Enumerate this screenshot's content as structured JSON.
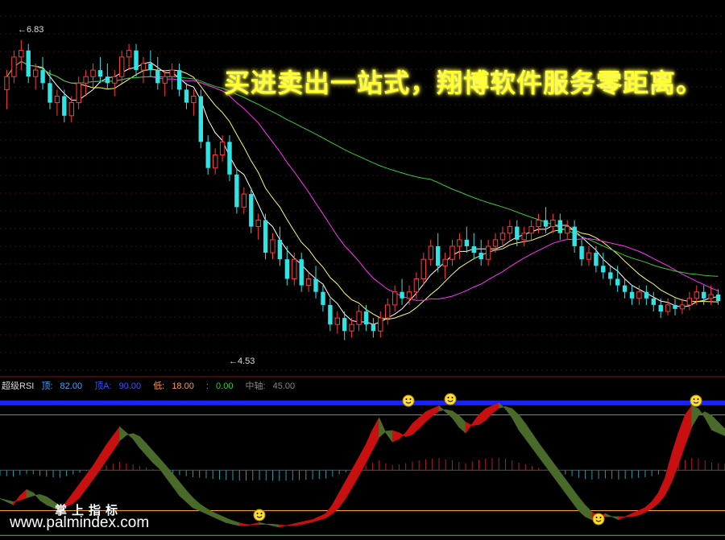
{
  "banner": "买进卖出一站式，翔博软件服务零距离。",
  "price_high_label": "6.83",
  "price_low_label": "4.53",
  "indicator": {
    "name": "超级RSI",
    "top_label": "顶:",
    "top_value": "82.00",
    "topA_label": "顶A:",
    "topA_value": "90.00",
    "low_label": "低:",
    "low_value": "18.00",
    "zero_label": ":",
    "zero_value": "0.00",
    "mid_label": "中轴:",
    "mid_value": "45.00",
    "colors": {
      "name": "#dddddd",
      "top": "#4aa3ff",
      "topA": "#3a55ff",
      "low": "#ff9a40",
      "zero": "#33cc33",
      "mid": "#888888"
    }
  },
  "watermark_cn": "掌上指标",
  "watermark_url": "www.palmindex.com",
  "colors": {
    "up": "#ff3b3b",
    "down": "#2ee5e5",
    "ma5": "#ffffff",
    "ma10": "#ffff66",
    "ma20": "#ff33ff",
    "ma60": "#33cc33",
    "rsi_up": "#c81010",
    "rsi_down": "#4a6a2a"
  },
  "chart_data": [
    {
      "type": "candlestick",
      "title": "",
      "series_names": [
        "MA5",
        "MA10",
        "MA20",
        "MA60"
      ],
      "ylim": [
        4.3,
        7.1
      ],
      "annotations": [
        {
          "text": "6.83",
          "x": 4
        },
        {
          "text": "4.53",
          "x": 47
        }
      ],
      "candles": [
        [
          6.45,
          6.6,
          6.3,
          6.55
        ],
        [
          6.55,
          6.75,
          6.5,
          6.7
        ],
        [
          6.7,
          6.83,
          6.6,
          6.75
        ],
        [
          6.75,
          6.8,
          6.5,
          6.55
        ],
        [
          6.55,
          6.65,
          6.45,
          6.6
        ],
        [
          6.6,
          6.7,
          6.45,
          6.5
        ],
        [
          6.5,
          6.6,
          6.3,
          6.35
        ],
        [
          6.35,
          6.45,
          6.25,
          6.4
        ],
        [
          6.4,
          6.45,
          6.2,
          6.25
        ],
        [
          6.25,
          6.4,
          6.2,
          6.35
        ],
        [
          6.35,
          6.55,
          6.3,
          6.5
        ],
        [
          6.5,
          6.6,
          6.4,
          6.55
        ],
        [
          6.55,
          6.65,
          6.45,
          6.6
        ],
        [
          6.6,
          6.7,
          6.5,
          6.55
        ],
        [
          6.55,
          6.65,
          6.45,
          6.5
        ],
        [
          6.5,
          6.6,
          6.4,
          6.55
        ],
        [
          6.55,
          6.75,
          6.5,
          6.7
        ],
        [
          6.7,
          6.8,
          6.6,
          6.75
        ],
        [
          6.75,
          6.8,
          6.55,
          6.6
        ],
        [
          6.6,
          6.7,
          6.5,
          6.65
        ],
        [
          6.65,
          6.75,
          6.55,
          6.6
        ],
        [
          6.6,
          6.7,
          6.45,
          6.5
        ],
        [
          6.5,
          6.6,
          6.4,
          6.55
        ],
        [
          6.55,
          6.65,
          6.45,
          6.6
        ],
        [
          6.6,
          6.65,
          6.4,
          6.45
        ],
        [
          6.45,
          6.5,
          6.3,
          6.35
        ],
        [
          6.35,
          6.45,
          6.25,
          6.4
        ],
        [
          6.4,
          6.45,
          6.0,
          6.05
        ],
        [
          6.05,
          6.1,
          5.8,
          5.85
        ],
        [
          5.85,
          6.0,
          5.8,
          5.95
        ],
        [
          5.95,
          6.1,
          5.9,
          6.05
        ],
        [
          6.05,
          6.1,
          5.75,
          5.8
        ],
        [
          5.8,
          5.85,
          5.5,
          5.55
        ],
        [
          5.55,
          5.7,
          5.5,
          5.65
        ],
        [
          5.65,
          5.7,
          5.35,
          5.4
        ],
        [
          5.4,
          5.5,
          5.3,
          5.45
        ],
        [
          5.45,
          5.5,
          5.15,
          5.2
        ],
        [
          5.2,
          5.35,
          5.15,
          5.3
        ],
        [
          5.3,
          5.4,
          5.1,
          5.15
        ],
        [
          5.15,
          5.25,
          4.95,
          5.0
        ],
        [
          5.0,
          5.2,
          4.95,
          5.15
        ],
        [
          5.15,
          5.2,
          4.9,
          4.95
        ],
        [
          4.95,
          5.05,
          4.9,
          5.0
        ],
        [
          5.0,
          5.1,
          4.85,
          4.9
        ],
        [
          4.9,
          4.95,
          4.75,
          4.8
        ],
        [
          4.8,
          4.85,
          4.6,
          4.65
        ],
        [
          4.65,
          4.75,
          4.58,
          4.7
        ],
        [
          4.7,
          4.75,
          4.53,
          4.6
        ],
        [
          4.6,
          4.7,
          4.55,
          4.65
        ],
        [
          4.65,
          4.8,
          4.6,
          4.75
        ],
        [
          4.75,
          4.8,
          4.6,
          4.65
        ],
        [
          4.65,
          4.7,
          4.55,
          4.6
        ],
        [
          4.6,
          4.75,
          4.55,
          4.7
        ],
        [
          4.7,
          4.85,
          4.65,
          4.8
        ],
        [
          4.8,
          4.95,
          4.75,
          4.9
        ],
        [
          4.9,
          5.0,
          4.8,
          4.85
        ],
        [
          4.85,
          4.95,
          4.8,
          4.9
        ],
        [
          4.9,
          5.05,
          4.85,
          5.0
        ],
        [
          5.0,
          5.2,
          4.95,
          5.15
        ],
        [
          5.15,
          5.3,
          5.1,
          5.25
        ],
        [
          5.25,
          5.35,
          5.05,
          5.1
        ],
        [
          5.1,
          5.2,
          5.0,
          5.15
        ],
        [
          5.15,
          5.3,
          5.1,
          5.25
        ],
        [
          5.25,
          5.35,
          5.15,
          5.3
        ],
        [
          5.3,
          5.4,
          5.2,
          5.25
        ],
        [
          5.25,
          5.35,
          5.15,
          5.2
        ],
        [
          5.2,
          5.3,
          5.1,
          5.15
        ],
        [
          5.15,
          5.3,
          5.1,
          5.25
        ],
        [
          5.25,
          5.35,
          5.2,
          5.3
        ],
        [
          5.3,
          5.4,
          5.25,
          5.35
        ],
        [
          5.35,
          5.45,
          5.3,
          5.4
        ],
        [
          5.4,
          5.45,
          5.25,
          5.3
        ],
        [
          5.3,
          5.4,
          5.25,
          5.35
        ],
        [
          5.35,
          5.45,
          5.3,
          5.4
        ],
        [
          5.4,
          5.5,
          5.35,
          5.45
        ],
        [
          5.45,
          5.55,
          5.35,
          5.4
        ],
        [
          5.4,
          5.5,
          5.35,
          5.45
        ],
        [
          5.45,
          5.5,
          5.3,
          5.35
        ],
        [
          5.35,
          5.45,
          5.3,
          5.4
        ],
        [
          5.4,
          5.45,
          5.2,
          5.25
        ],
        [
          5.25,
          5.3,
          5.1,
          5.15
        ],
        [
          5.15,
          5.25,
          5.1,
          5.2
        ],
        [
          5.2,
          5.25,
          5.05,
          5.1
        ],
        [
          5.1,
          5.2,
          5.0,
          5.05
        ],
        [
          5.05,
          5.1,
          4.95,
          5.0
        ],
        [
          5.0,
          5.1,
          4.9,
          4.95
        ],
        [
          4.95,
          5.0,
          4.85,
          4.9
        ],
        [
          4.9,
          4.95,
          4.8,
          4.85
        ],
        [
          4.85,
          4.95,
          4.8,
          4.9
        ],
        [
          4.9,
          4.95,
          4.8,
          4.85
        ],
        [
          4.85,
          4.9,
          4.75,
          4.8
        ],
        [
          4.8,
          4.85,
          4.7,
          4.75
        ],
        [
          4.75,
          4.85,
          4.72,
          4.8
        ],
        [
          4.8,
          4.85,
          4.72,
          4.77
        ],
        [
          4.77,
          4.85,
          4.73,
          4.8
        ],
        [
          4.8,
          4.9,
          4.76,
          4.85
        ],
        [
          4.85,
          4.95,
          4.8,
          4.9
        ],
        [
          4.9,
          4.95,
          4.8,
          4.85
        ],
        [
          4.85,
          4.95,
          4.8,
          4.88
        ],
        [
          4.88,
          4.92,
          4.8,
          4.83
        ]
      ]
    },
    {
      "type": "area",
      "title": "超级RSI",
      "ylim": [
        0,
        100
      ],
      "reference_lines": {
        "top": 82,
        "topA": 90,
        "low": 18,
        "zero": 0,
        "mid": 45
      },
      "values": [
        26,
        24,
        22,
        28,
        32,
        30,
        25,
        22,
        20,
        18,
        24,
        30,
        36,
        42,
        48,
        55,
        62,
        68,
        74,
        70,
        66,
        60,
        55,
        50,
        46,
        40,
        34,
        28,
        24,
        20,
        18,
        16,
        14,
        12,
        10,
        9,
        8,
        8,
        9,
        10,
        9,
        8,
        7,
        8,
        9,
        10,
        11,
        12,
        14,
        16,
        22,
        30,
        38,
        46,
        54,
        62,
        72,
        80,
        70,
        64,
        66,
        70,
        76,
        80,
        84,
        86,
        88,
        84,
        80,
        74,
        70,
        76,
        82,
        86,
        88,
        90,
        86,
        80,
        72,
        66,
        60,
        54,
        48,
        42,
        36,
        30,
        24,
        18,
        14,
        12,
        14,
        16,
        14,
        12,
        14,
        16,
        18,
        20,
        24,
        30,
        40,
        56,
        70,
        82,
        88,
        86,
        80,
        72,
        70,
        68
      ]
    }
  ]
}
